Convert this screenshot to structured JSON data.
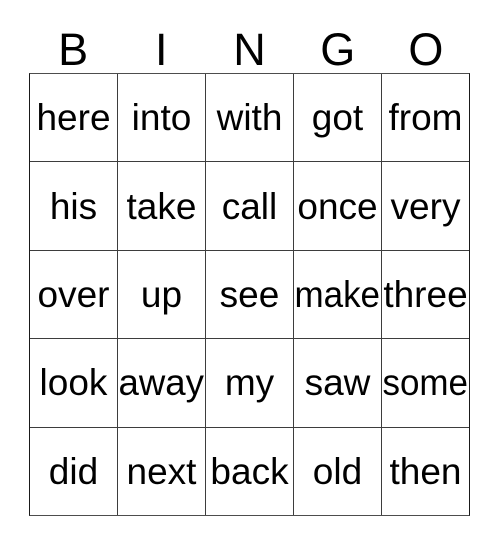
{
  "card": {
    "title": "BINGO",
    "header_letters": [
      "B",
      "I",
      "N",
      "G",
      "O"
    ],
    "columns": 5,
    "rows": 5,
    "text_color": "#000000",
    "background_color": "#ffffff",
    "border_color": "#1a1a1a",
    "grid": [
      [
        "here",
        "into",
        "with",
        "got",
        "from"
      ],
      [
        "his",
        "take",
        "call",
        "once",
        "very"
      ],
      [
        "over",
        "up",
        "see",
        "make",
        "three"
      ],
      [
        "look",
        "away",
        "my",
        "saw",
        "some"
      ],
      [
        "did",
        "next",
        "back",
        "old",
        "then"
      ]
    ]
  }
}
